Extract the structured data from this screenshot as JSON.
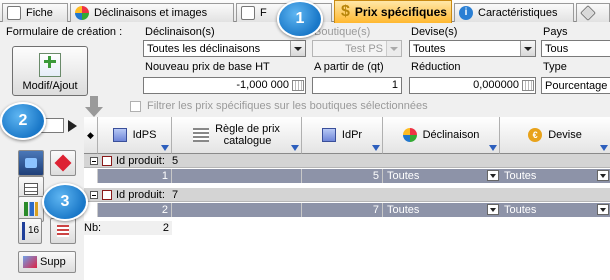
{
  "tabs": [
    {
      "label": "Fiche",
      "icon": "document-icon"
    },
    {
      "label": "Déclinaisons et images",
      "icon": "photos-icon"
    },
    {
      "label": "F",
      "icon": "features-icon"
    },
    {
      "label": "Prix spécifiques",
      "icon": "dollar-icon"
    },
    {
      "label": "Caractéristiques",
      "icon": "info-icon"
    },
    {
      "label": "",
      "icon": "tag-icon"
    }
  ],
  "badges": [
    "1",
    "2",
    "3"
  ],
  "form": {
    "title": "Formulaire de création :",
    "create_button": "Modif/Ajout",
    "declinaison_label": "Déclinaison(s)",
    "declinaison_value": "Toutes les déclinaisons",
    "boutique_label": "Boutique(s)",
    "boutique_value": "Test PS",
    "devise_label": "Devise(s)",
    "devise_value": "Toutes",
    "pays_label": "Pays",
    "pays_value": "Tous",
    "base_price_label": "Nouveau prix de base HT",
    "base_price_value": "-1,000 000",
    "from_qty_label": "A partir de (qt)",
    "from_qty_value": "1",
    "reduction_label": "Réduction",
    "reduction_value": "0,000000",
    "type_label": "Type",
    "type_value": "Pourcentage",
    "filter_label": "Filtrer les prix spécifiques sur les boutiques sélectionnées"
  },
  "grid": {
    "columns": [
      {
        "label": "IdPS",
        "icon": "idps-icon"
      },
      {
        "label": "Règle de prix\ncatalogue",
        "icon": "catalog-rule-icon"
      },
      {
        "label": "IdPr",
        "icon": "idpr-icon"
      },
      {
        "label": "Déclinaison",
        "icon": "declinaison-icon"
      },
      {
        "label": "Devise",
        "icon": "euro-icon"
      }
    ],
    "groups": [
      {
        "label": "Id produit:",
        "value": "5",
        "row": {
          "idps": "1",
          "rule": "",
          "idpr": "5",
          "declinaison": "Toutes",
          "devise": "Toutes"
        }
      },
      {
        "label": "Id produit:",
        "value": "7",
        "row": {
          "idps": "2",
          "rule": "",
          "idpr": "7",
          "declinaison": "Toutes",
          "devise": "Toutes"
        }
      }
    ],
    "count_label": "Nb:",
    "count_value": "2"
  },
  "side": {
    "page_input": "",
    "delete_button": "Supp",
    "counter": "16"
  },
  "colors": {
    "active_tab": "#ffb830",
    "badge": "#1a78c8",
    "selected_row": "#8d93a8",
    "group_row": "#d4d4d4"
  }
}
